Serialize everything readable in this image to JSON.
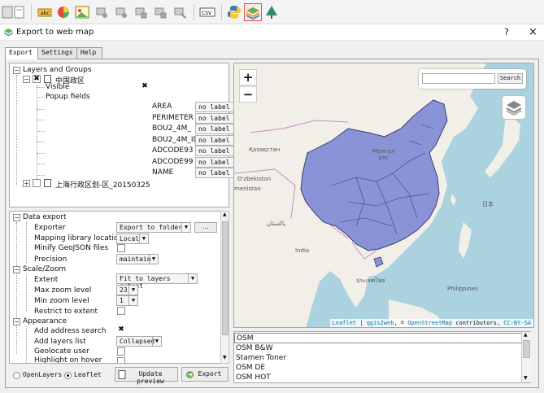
{
  "toolbar": {
    "icons": [
      "save-icon",
      "document-icon",
      "label-icon",
      "style-icon",
      "image-icon",
      "layer-tool-icon-1",
      "layer-tool-icon-2",
      "layer-tool-icon-3",
      "layer-tool-icon-4",
      "layer-tool-icon-5",
      "csv-icon",
      "python-icon",
      "qgis2web-icon",
      "tree-icon"
    ],
    "csv_label": "CSV"
  },
  "window": {
    "title": "Export to web map",
    "help": "?",
    "close": "×"
  },
  "tabs": [
    {
      "label": "Export",
      "active": true
    },
    {
      "label": "Settings",
      "active": false
    },
    {
      "label": "Help",
      "active": false
    }
  ],
  "layers": {
    "root_label": "Layers and Groups",
    "layer1": {
      "name": "中国政区",
      "visible_label": "Visible",
      "popup_label": "Popup fields",
      "fields": [
        {
          "name": "AREA",
          "label": "no label"
        },
        {
          "name": "PERIMETER",
          "label": "no label"
        },
        {
          "name": "BOU2_4M_",
          "label": "no label"
        },
        {
          "name": "BOU2_4M_ID",
          "label": "no label"
        },
        {
          "name": "ADCODE93",
          "label": "no label"
        },
        {
          "name": "ADCODE99",
          "label": "no label"
        },
        {
          "name": "NAME",
          "label": "no label"
        }
      ]
    },
    "layer2": {
      "name": "上海行政区划-区_20150325"
    }
  },
  "settings": {
    "data_export": "Data export",
    "exporter_label": "Exporter",
    "exporter_value": "Export to folder",
    "browse_label": "...",
    "mapping_label": "Mapping library location",
    "mapping_value": "Local",
    "minify_label": "Minify GeoJSON files",
    "precision_label": "Precision",
    "precision_value": "maintain",
    "scale_zoom": "Scale/Zoom",
    "extent_label": "Extent",
    "extent_value": "Fit to layers extent",
    "max_zoom_label": "Max zoom level",
    "max_zoom_value": "23",
    "min_zoom_label": "Min zoom level",
    "min_zoom_value": "1",
    "restrict_label": "Restrict to extent",
    "appearance": "Appearance",
    "address_search_label": "Add address search",
    "layers_list_label": "Add layers list",
    "layers_list_value": "Collapsed",
    "geolocate_label": "Geolocate user",
    "highlight_label": "Highlight on hover"
  },
  "bottom": {
    "openlayers": "OpenLayers",
    "leaflet": "Leaflet",
    "update_preview": "Update preview",
    "export": "Export"
  },
  "map": {
    "zoom_in": "+",
    "zoom_out": "−",
    "search_button": "Search",
    "labels": {
      "kazakhstan": "Қазақстан",
      "mongolia": "Монгол\nулс",
      "uzbekistan": "O'zbekiston",
      "turkmenistan": "menistan",
      "pakistan": "پاکستان",
      "india": "India",
      "thailand": "ประเทศไทย",
      "philippines": "Philippines",
      "japan": "日本"
    },
    "attribution": {
      "leaflet": "Leaflet",
      "sep1": " | ",
      "qgis2web": "qgis2web",
      "sep2": ", © ",
      "osm": "OpenStreetMap",
      "contributors": " contributors, ",
      "license": "CC-BY-SA"
    },
    "colors": {
      "water": "#aad3df",
      "land": "#f2efe9",
      "layer_fill": "#8b93d8",
      "layer_stroke": "#3a3f6e"
    }
  },
  "basemaps": [
    "OSM",
    "OSM B&W",
    "Stamen Toner",
    "OSM DE",
    "OSM HOT"
  ]
}
